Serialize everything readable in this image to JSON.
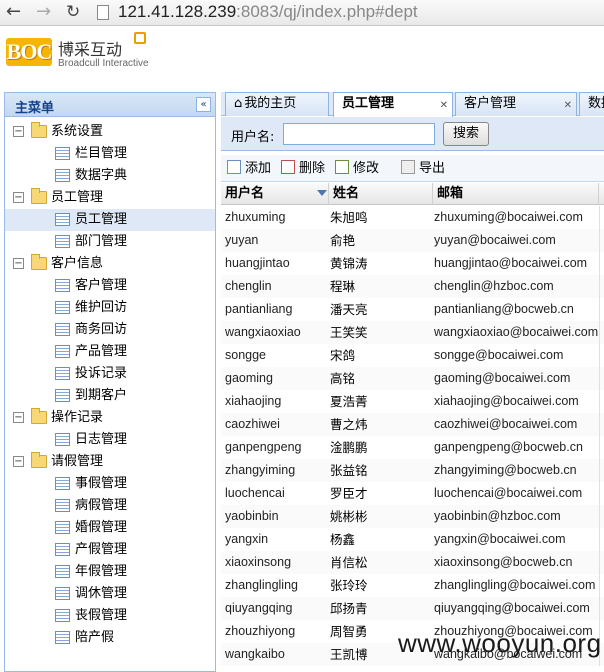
{
  "browser": {
    "url_host": "121.41.128.239",
    "url_rest": ":8083/qj/index.php#dept"
  },
  "header": {
    "logo_mark": "BOC",
    "logo_cn": "博采互动",
    "logo_en": "Broadcull Interactive"
  },
  "sidebar": {
    "title": "主菜单",
    "collapse_glyph": "«",
    "groups": [
      {
        "label": "系统设置",
        "items": [
          "栏目管理",
          "数据字典"
        ]
      },
      {
        "label": "员工管理",
        "items": [
          "员工管理",
          "部门管理"
        ]
      },
      {
        "label": "客户信息",
        "items": [
          "客户管理",
          "维护回访",
          "商务回访",
          "产品管理",
          "投诉记录",
          "到期客户"
        ]
      },
      {
        "label": "操作记录",
        "items": [
          "日志管理"
        ]
      },
      {
        "label": "请假管理",
        "items": [
          "事假管理",
          "病假管理",
          "婚假管理",
          "产假管理",
          "年假管理",
          "调休管理",
          "丧假管理",
          "陪产假"
        ]
      }
    ],
    "selected": "员工管理"
  },
  "tabs": [
    {
      "label": "我的主页",
      "closable": false
    },
    {
      "label": "员工管理",
      "closable": true,
      "active": true
    },
    {
      "label": "客户管理",
      "closable": true
    },
    {
      "label": "数据",
      "closable": false
    }
  ],
  "search": {
    "label": "用户名:",
    "value": "",
    "button": "搜索"
  },
  "toolbar": {
    "add": "添加",
    "delete": "删除",
    "edit": "修改",
    "export": "导出"
  },
  "grid": {
    "columns": [
      "用户名",
      "姓名",
      "邮箱"
    ],
    "rows": [
      [
        "zhuxuming",
        "朱旭鸣",
        "zhuxuming@bocaiwei.com"
      ],
      [
        "yuyan",
        "俞艳",
        "yuyan@bocaiwei.com"
      ],
      [
        "huangjintao",
        "黄锦涛",
        "huangjintao@bocaiwei.com"
      ],
      [
        "chenglin",
        "程琳",
        "chenglin@hzboc.com"
      ],
      [
        "pantianliang",
        "潘天亮",
        "pantianliang@bocweb.cn"
      ],
      [
        "wangxiaoxiao",
        "王笑笑",
        "wangxiaoxiao@bocaiwei.com"
      ],
      [
        "songge",
        "宋鸽",
        "songge@bocaiwei.com"
      ],
      [
        "gaoming",
        "高铭",
        "gaoming@bocaiwei.com"
      ],
      [
        "xiahaojing",
        "夏浩菁",
        "xiahaojing@bocaiwei.com"
      ],
      [
        "caozhiwei",
        "曹之炜",
        "caozhiwei@bocaiwei.com"
      ],
      [
        "ganpengpeng",
        "淦鹏鹏",
        "ganpengpeng@bocweb.cn"
      ],
      [
        "zhangyiming",
        "张益铭",
        "zhangyiming@bocweb.cn"
      ],
      [
        "luochencai",
        "罗臣才",
        "luochencai@bocaiwei.com"
      ],
      [
        "yaobinbin",
        "姚彬彬",
        "yaobinbin@hzboc.com"
      ],
      [
        "yangxin",
        "杨鑫",
        "yangxin@bocaiwei.com"
      ],
      [
        "xiaoxinsong",
        "肖信松",
        "xiaoxinsong@bocweb.cn"
      ],
      [
        "zhanglingling",
        "张玲玲",
        "zhanglingling@bocaiwei.com"
      ],
      [
        "qiuyangqing",
        "邱扬青",
        "qiuyangqing@bocaiwei.com"
      ],
      [
        "zhouzhiyong",
        "周智勇",
        "zhouzhiyong@bocaiwei.com"
      ],
      [
        "wangkaibo",
        "王凯博",
        "wangkaibo@bocaiwei.com"
      ]
    ]
  },
  "watermark": "www.wooyun.org"
}
